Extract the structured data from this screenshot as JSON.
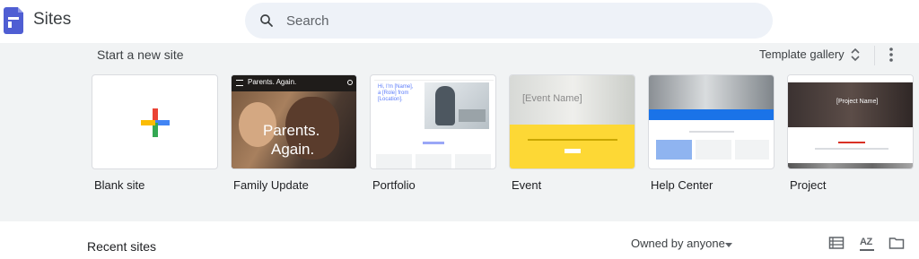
{
  "app": {
    "title": "Sites"
  },
  "search": {
    "placeholder": "Search"
  },
  "new_site": {
    "title": "Start a new site",
    "gallery_label": "Template gallery",
    "templates": [
      {
        "label": "Blank site"
      },
      {
        "label": "Family Update",
        "header_text": "Parents. Again.",
        "hero_text_1": "Parents.",
        "hero_text_2": "Again."
      },
      {
        "label": "Portfolio",
        "intro_text_1": "Hi, I'm [Name],",
        "intro_text_2": "a [Role] from",
        "intro_text_3": "[Location]."
      },
      {
        "label": "Event",
        "hero_text": "[Event Name]"
      },
      {
        "label": "Help Center"
      },
      {
        "label": "Project",
        "hero_text": "[Project Name]"
      }
    ]
  },
  "recent": {
    "title": "Recent sites",
    "owner_filter": "Owned by anyone",
    "sort_label": "AZ"
  },
  "colors": {
    "brand": "#4f5ed3",
    "plus_red": "#ea4335",
    "plus_blue": "#4285f4",
    "plus_green": "#34a853",
    "plus_yellow": "#fbbc04",
    "event_yellow": "#fdd835",
    "help_blue": "#1a73e8"
  }
}
